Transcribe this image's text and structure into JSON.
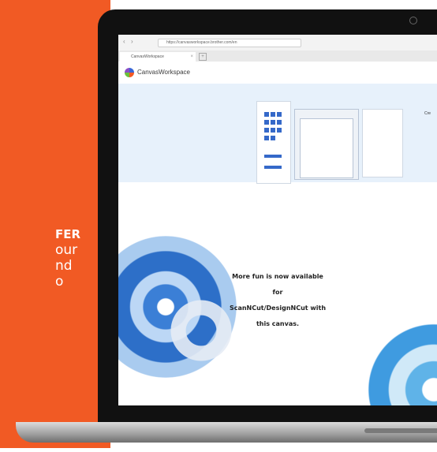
{
  "promo": {
    "line1": "FER",
    "line2": "our",
    "line3": "nd",
    "line4": "o",
    "bg_color": "#f15a24"
  },
  "browser": {
    "url": "https://canvasworkspace.brother.com/en",
    "tab_title": "CanvasWorkspace"
  },
  "app": {
    "logo_text": "CanvasWorkspace",
    "hero_caption": "Cre"
  },
  "message": {
    "line1": "More fun is now available for",
    "line2": "ScanNCut/DesignNCut with",
    "line3": "this canvas."
  },
  "icons": [
    "back-arrow-icon",
    "forward-arrow-icon",
    "close-icon",
    "camera-icon",
    "logo-icon"
  ]
}
